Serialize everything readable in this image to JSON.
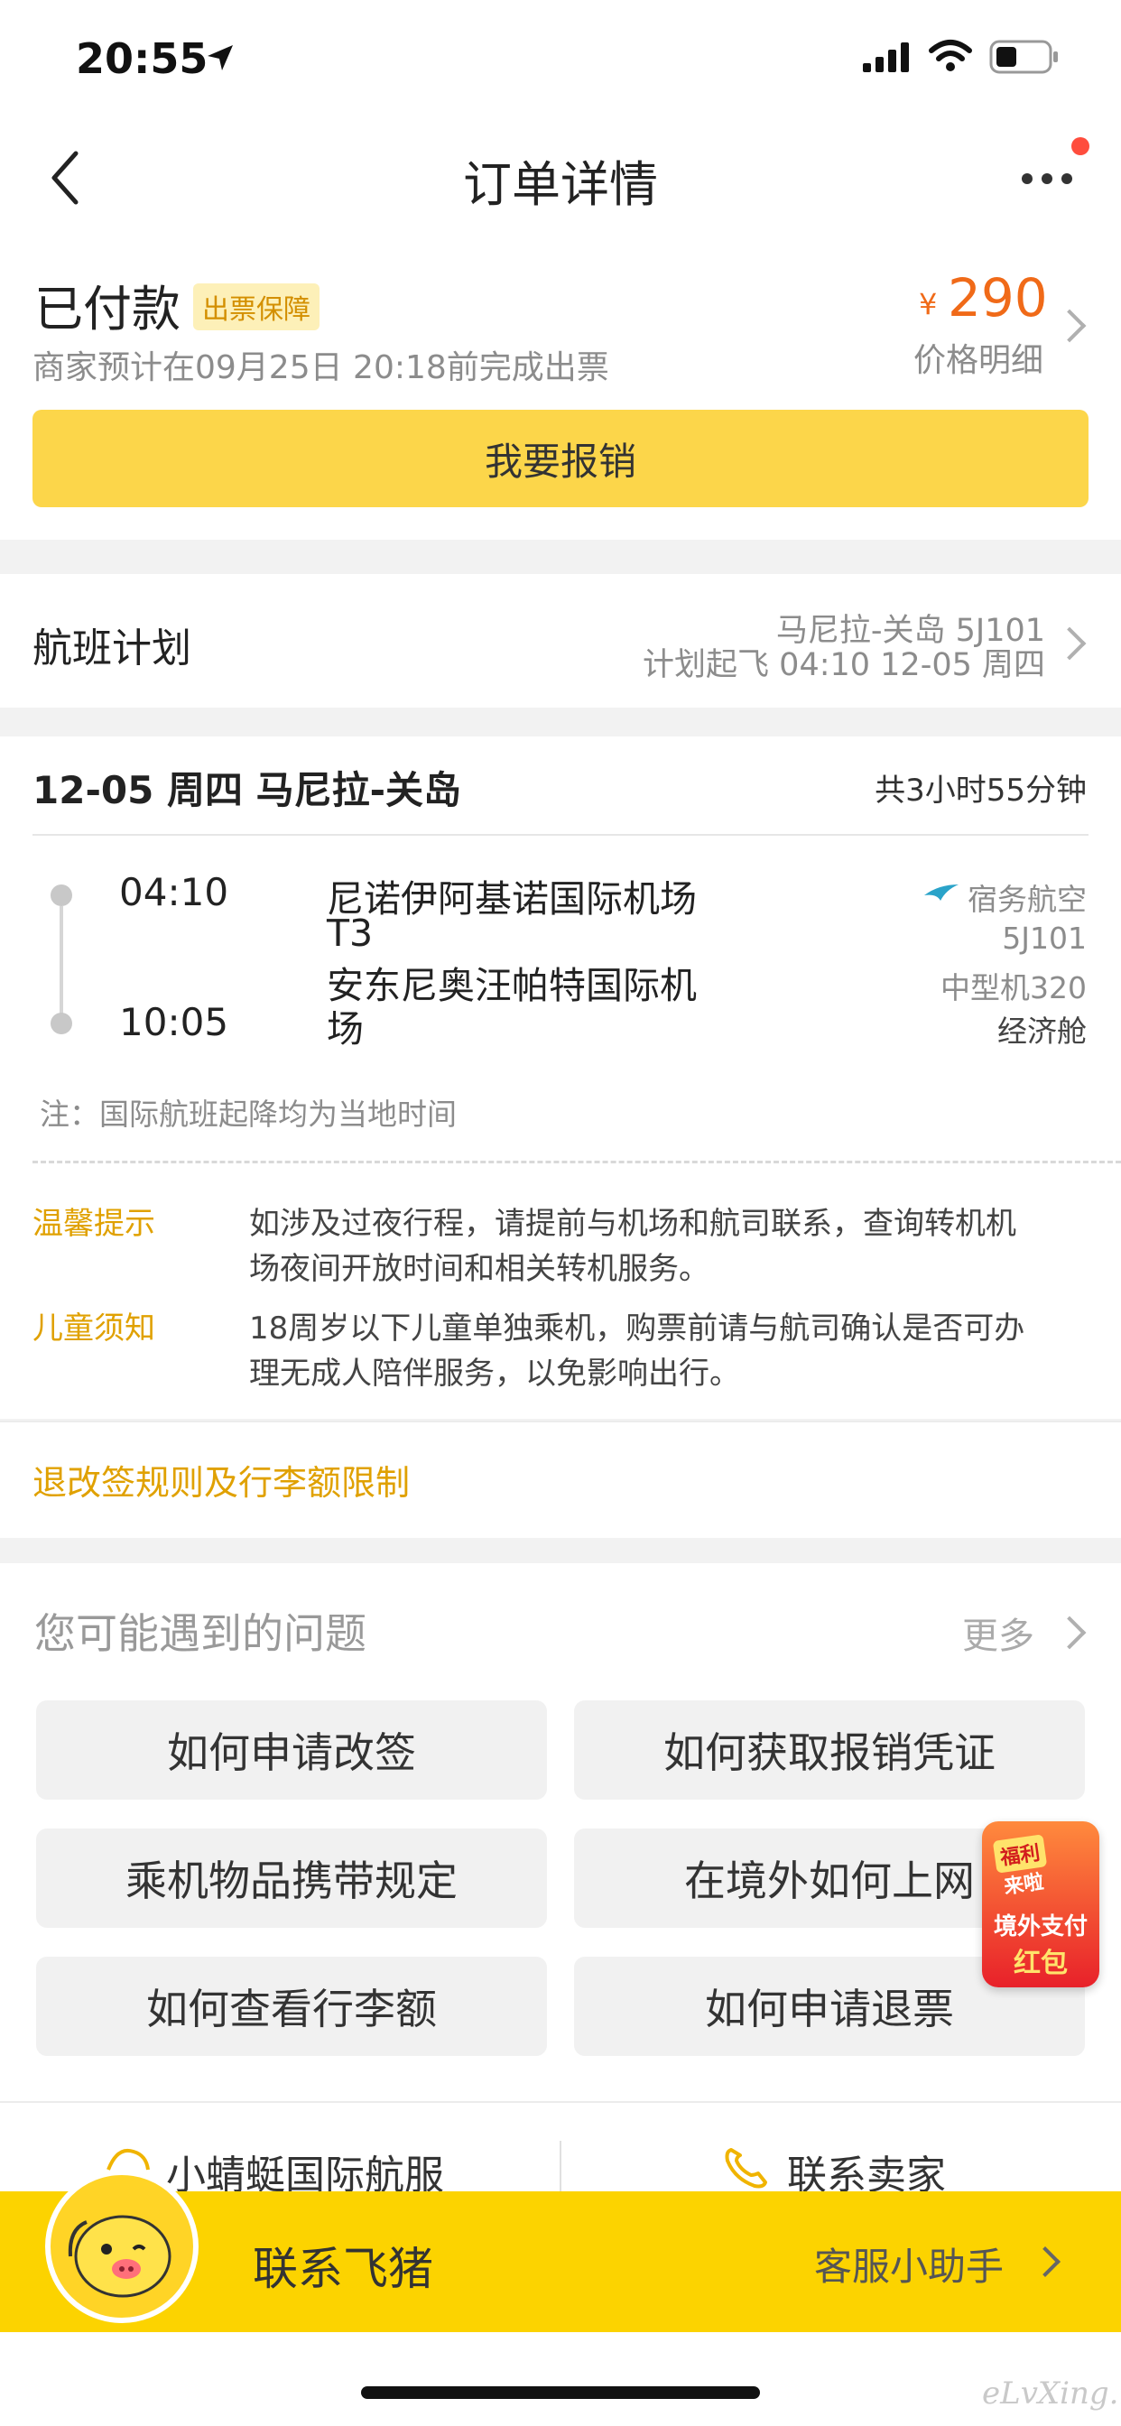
{
  "status_bar": {
    "time": "20:55"
  },
  "nav": {
    "title": "订单详情"
  },
  "order": {
    "status": "已付款",
    "badge": "出票保障",
    "currency": "¥",
    "price": "290",
    "price_detail": "价格明细",
    "ticket_note": "商家预计在09月25日 20:18前完成出票",
    "reimburse_button": "我要报销"
  },
  "plan": {
    "label": "航班计划",
    "route": "马尼拉-关岛 5J101",
    "schedule": "计划起飞 04:10 12-05 周四"
  },
  "flight": {
    "date_route": "12-05 周四 马尼拉-关岛",
    "duration": "共3小时55分钟",
    "dep_time": "04:10",
    "arr_time": "10:05",
    "dep_airport_line1": "尼诺伊阿基诺国际机场",
    "dep_airport_line2": "T3",
    "arr_airport_line1": "安东尼奥汪帕特国际机",
    "arr_airport_line2": "场",
    "airline": "宿务航空",
    "flight_no": "5J101",
    "aircraft": "中型机320",
    "cabin": "经济舱",
    "note": "注：国际航班起降均为当地时间"
  },
  "tips": [
    {
      "label": "温馨提示",
      "line1": "如涉及过夜行程，请提前与机场和航司联系，查询转机机",
      "line2": "场夜间开放时间和相关转机服务。"
    },
    {
      "label": "儿童须知",
      "line1": "18周岁以下儿童单独乘机，购票前请与航司确认是否可办",
      "line2": "理无成人陪伴服务，以免影响出行。"
    }
  ],
  "rules_link": "退改签规则及行李额限制",
  "faq": {
    "title": "您可能遇到的问题",
    "more": "更多",
    "items": [
      "如何申请改签",
      "如何获取报销凭证",
      "乘机物品携带规定",
      "在境外如何上网",
      "如何查看行李额",
      "如何申请退票"
    ]
  },
  "promo": {
    "line1": "福利",
    "line2": "来啦",
    "line3": "境外支付",
    "line4": "红包"
  },
  "service": {
    "left": "小蜻蜓国际航服",
    "right": "联系卖家"
  },
  "bottom_bar": {
    "title": "联系飞猪",
    "assistant": "客服小助手"
  },
  "watermark": "eLvXing.net",
  "colors": {
    "accent_yellow": "#fcd64a",
    "price_orange": "#f06a18",
    "gold_text": "#e0a100"
  }
}
